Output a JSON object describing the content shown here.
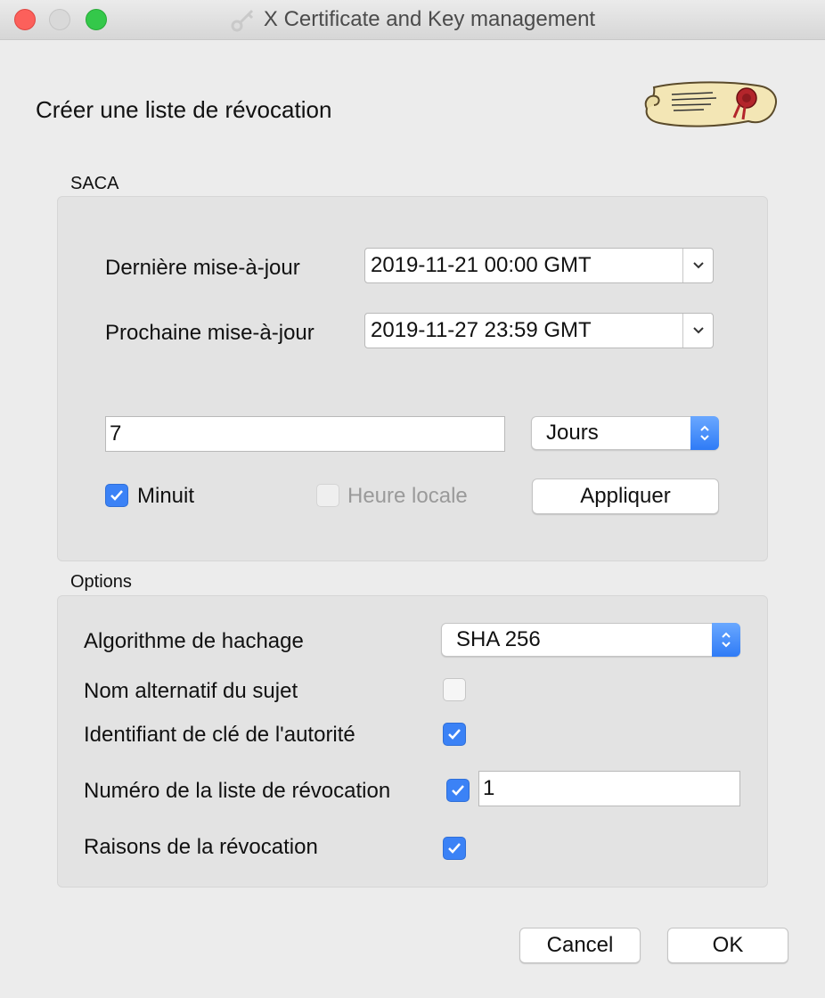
{
  "window": {
    "title": "X Certificate and Key management",
    "heading": "Créer une liste de révocation"
  },
  "saca": {
    "group_label": "SACA",
    "last_update_label": "Dernière mise-à-jour",
    "last_update_value": "2019-11-21 00:00 GMT",
    "next_update_label": "Prochaine mise-à-jour",
    "next_update_value": "2019-11-27 23:59 GMT",
    "interval_value": "7",
    "interval_unit": "Jours",
    "midnight_label": "Minuit",
    "midnight_checked": true,
    "local_time_label": "Heure locale",
    "local_time_checked": false,
    "apply_label": "Appliquer"
  },
  "options": {
    "group_label": "Options",
    "hash_label": "Algorithme de hachage",
    "hash_value": "SHA 256",
    "subject_alt_name_label": "Nom alternatif du sujet",
    "subject_alt_name_checked": false,
    "authority_key_id_label": "Identifiant de clé de l'autorité",
    "authority_key_id_checked": true,
    "crl_number_label": "Numéro de la liste de révocation",
    "crl_number_checked": true,
    "crl_number_value": "1",
    "revocation_reasons_label": "Raisons de la révocation",
    "revocation_reasons_checked": true
  },
  "buttons": {
    "cancel": "Cancel",
    "ok": "OK"
  },
  "colors": {
    "accent": "#3b82f6",
    "window_bg": "#ececec",
    "group_bg": "#e3e3e3"
  }
}
